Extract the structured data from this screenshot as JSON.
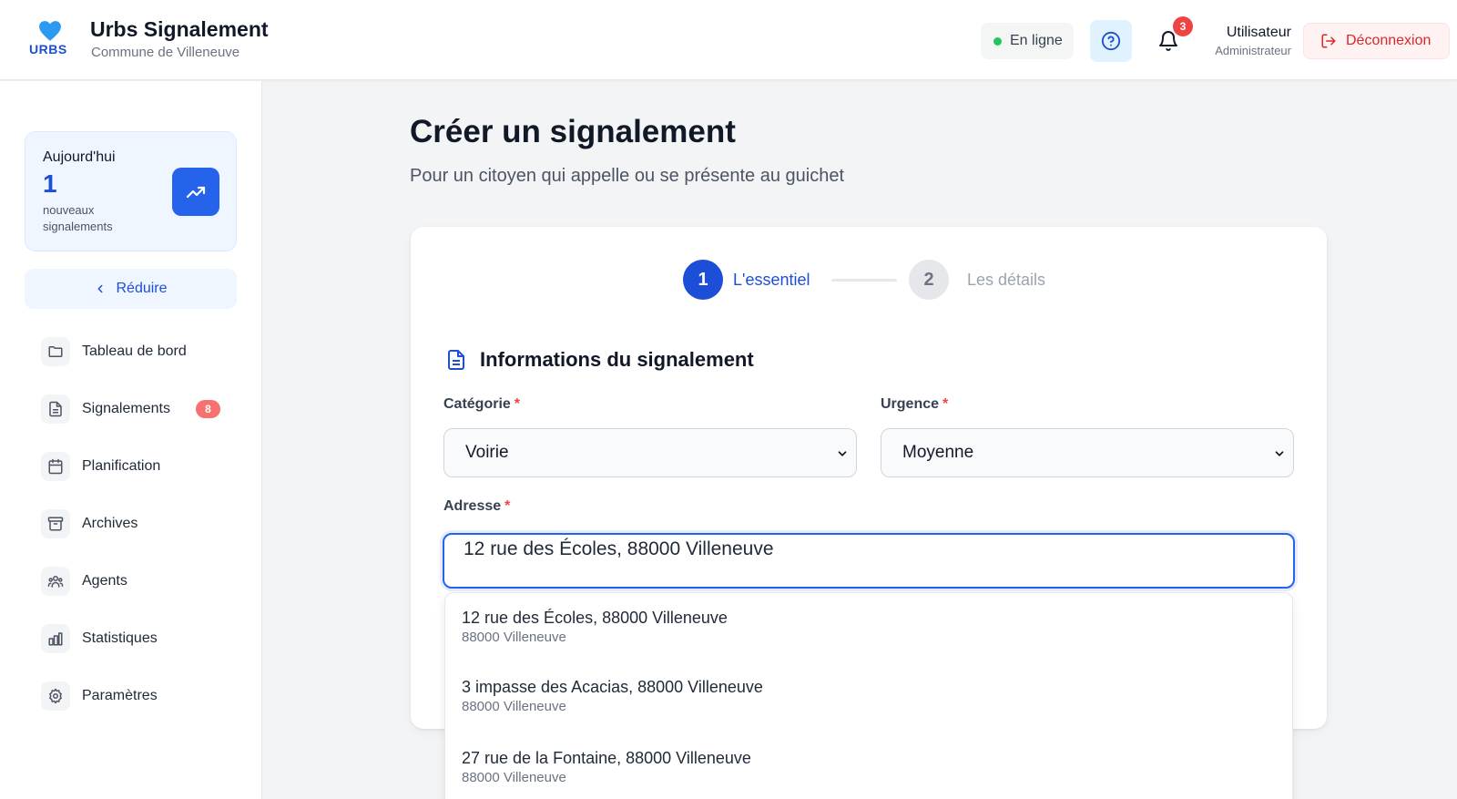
{
  "header": {
    "logo_text": "URBS",
    "app_title": "Urbs Signalement",
    "app_subtitle": "Commune de Villeneuve",
    "status": "En ligne",
    "notifications_count": "3",
    "user_name": "Utilisateur",
    "user_role": "Administrateur",
    "logout_label": "Déconnexion",
    "icons": [
      "heart-icon",
      "help-icon",
      "bell-icon",
      "logout-icon"
    ]
  },
  "sidebar": {
    "today": {
      "label": "Aujourd'hui",
      "count": "1",
      "sublabel": "nouveaux signalements"
    },
    "reduce_label": "Réduire",
    "items": [
      {
        "label": "Tableau de bord",
        "icon": "folder-icon"
      },
      {
        "label": "Signalements",
        "icon": "document-icon",
        "badge": "8"
      },
      {
        "label": "Planification",
        "icon": "calendar-icon"
      },
      {
        "label": "Archives",
        "icon": "archive-icon"
      },
      {
        "label": "Agents",
        "icon": "users-icon"
      },
      {
        "label": "Statistiques",
        "icon": "bar-chart-icon"
      },
      {
        "label": "Paramètres",
        "icon": "gear-icon"
      }
    ]
  },
  "main": {
    "title": "Créer un signalement",
    "subtitle": "Pour un citoyen qui appelle ou se présente au guichet",
    "stepper": [
      {
        "number": "1",
        "label": "L'essentiel",
        "active": true
      },
      {
        "number": "2",
        "label": "Les détails",
        "active": false
      }
    ],
    "section_title": "Informations du signalement",
    "form": {
      "category_label": "Catégorie",
      "category_value": "Voirie",
      "urgency_label": "Urgence",
      "urgency_value": "Moyenne",
      "required_mark": "*",
      "address_label": "Adresse",
      "address_value": "12 rue des Écoles, 88000 Villeneuve"
    },
    "suggestions": [
      {
        "main": "12 rue des Écoles, 88000 Villeneuve",
        "sub": "88000 Villeneuve"
      },
      {
        "main": "3 impasse des Acacias, 88000 Villeneuve",
        "sub": "88000 Villeneuve"
      },
      {
        "main": "27 rue de la Fontaine, 88000 Villeneuve",
        "sub": "88000 Villeneuve"
      }
    ]
  },
  "colors": {
    "primary": "#1d4ed8",
    "danger": "#dc2626",
    "online": "#22c55e"
  }
}
